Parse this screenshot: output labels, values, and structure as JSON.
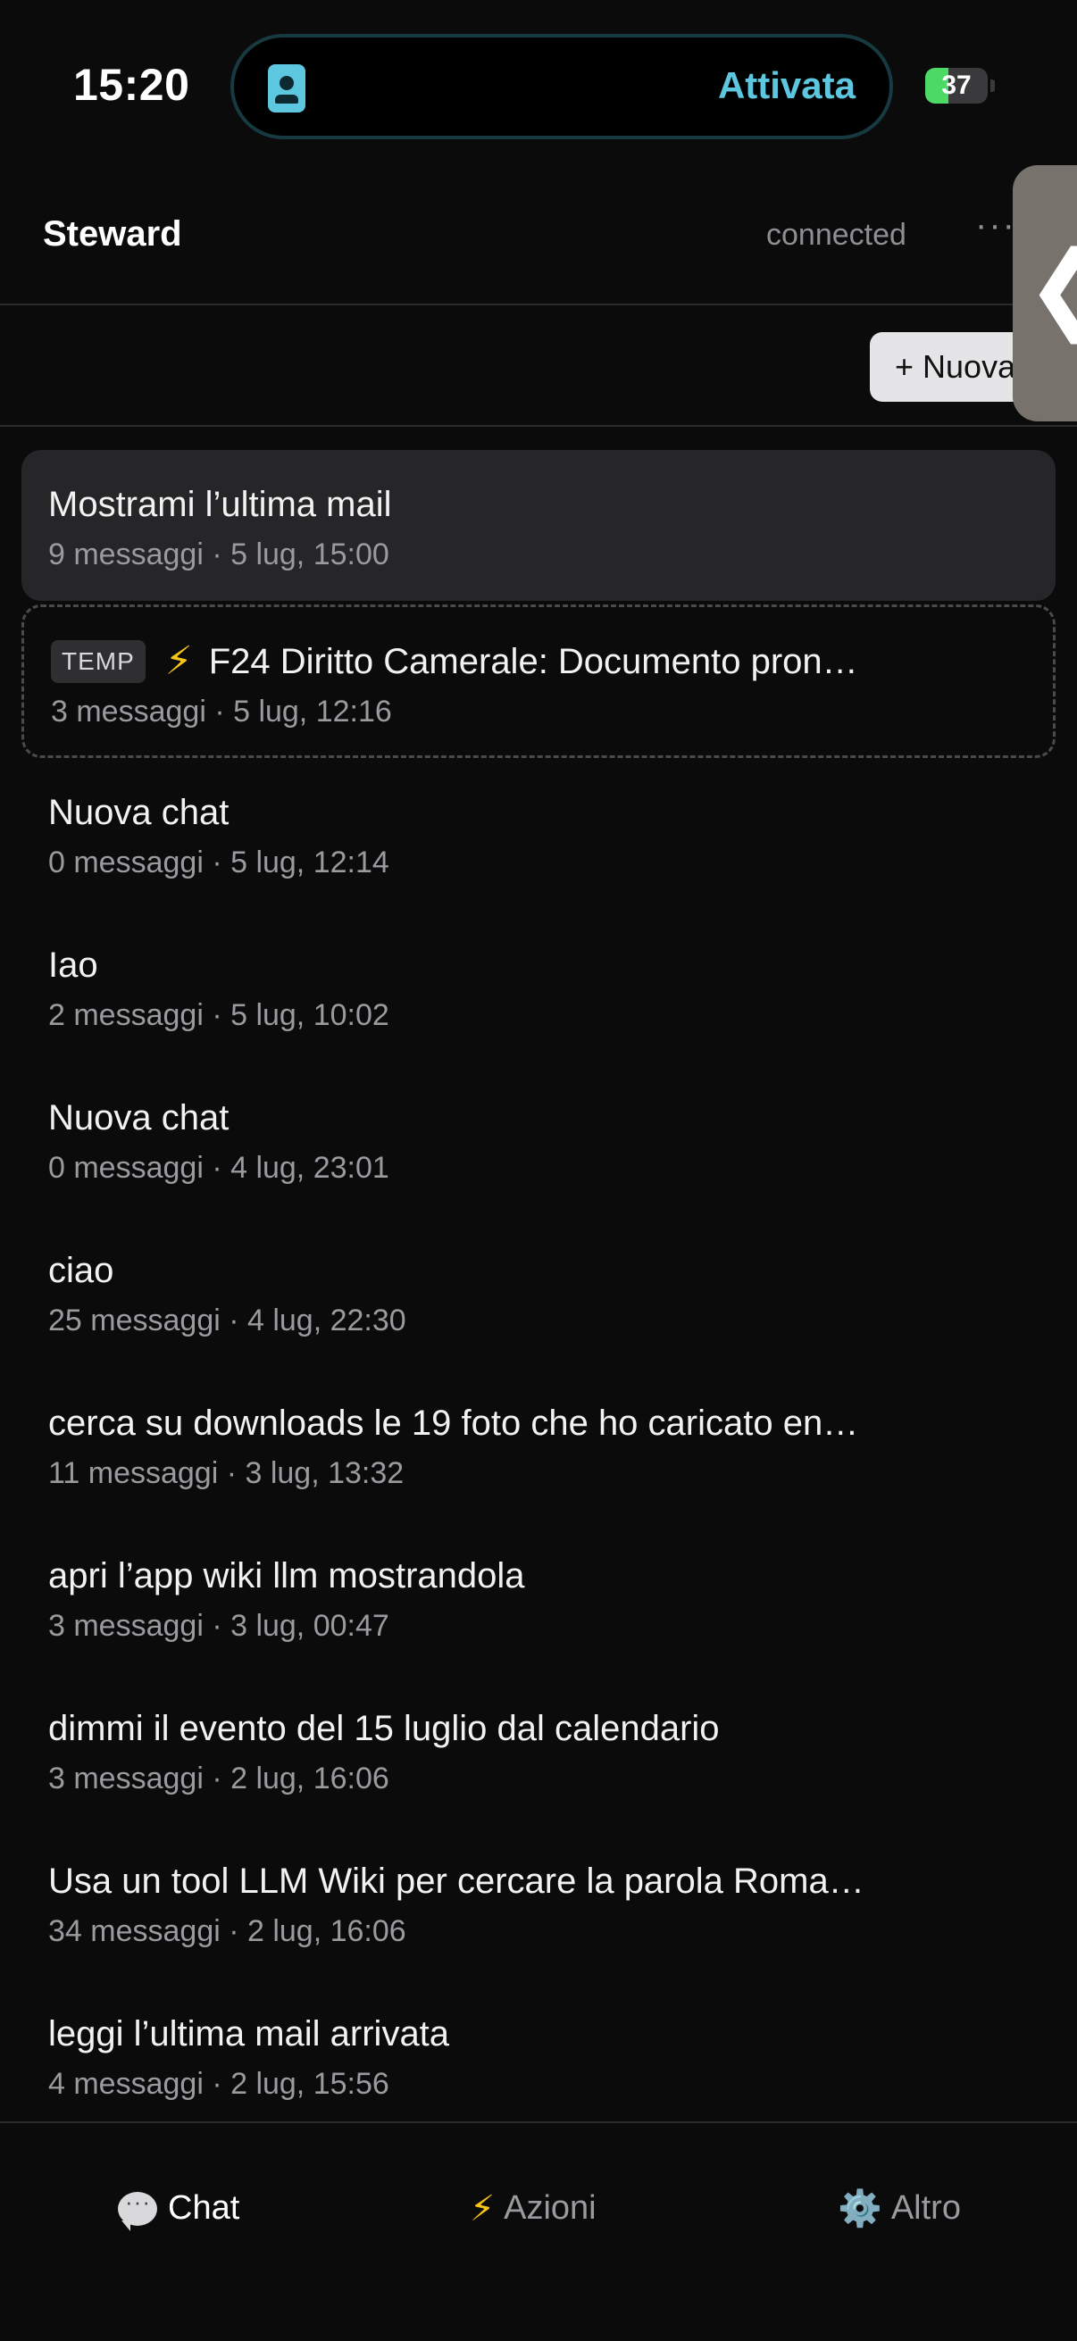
{
  "status_bar": {
    "time": "15:20",
    "activity_text": "Attivata",
    "activity_icon": "badge-icon",
    "battery_level": 37,
    "battery_text": "37",
    "accent_color": "#5cc7df"
  },
  "header": {
    "title": "Steward",
    "connection_status": "connected",
    "more_label": "···"
  },
  "side_handle": {
    "glyph": "❮"
  },
  "toolbar": {
    "new_label": "+ Nuova"
  },
  "chats": [
    {
      "title": "Mostrami l’ultima mail",
      "meta": "9 messaggi · 5 lug, 15:00",
      "active": true
    },
    {
      "badge": "TEMP",
      "title": "F24 Diritto Camerale: Documento pron…",
      "meta": "3 messaggi · 5 lug, 12:16",
      "temp": true
    },
    {
      "title": "Nuova chat",
      "meta": "0 messaggi · 5 lug, 12:14"
    },
    {
      "title": "Iao",
      "meta": "2 messaggi · 5 lug, 10:02"
    },
    {
      "title": "Nuova chat",
      "meta": "0 messaggi · 4 lug, 23:01"
    },
    {
      "title": "ciao",
      "meta": "25 messaggi · 4 lug, 22:30"
    },
    {
      "title": "cerca su downloads le 19 foto che ho caricato en…",
      "meta": "11 messaggi · 3 lug, 13:32"
    },
    {
      "title": "apri l’app wiki llm mostrandola",
      "meta": "3 messaggi · 3 lug, 00:47"
    },
    {
      "title": "dimmi il evento del 15 luglio dal calendario",
      "meta": "3 messaggi · 2 lug, 16:06"
    },
    {
      "title": "Usa un tool LLM Wiki per cercare la parola Roma…",
      "meta": "34 messaggi · 2 lug, 16:06"
    },
    {
      "title": "leggi l’ultima mail arrivata",
      "meta": "4 messaggi · 2 lug, 15:56"
    }
  ],
  "tabs": [
    {
      "label": "Chat",
      "icon": "speech-bubble-icon",
      "active": true
    },
    {
      "label": "Azioni",
      "icon": "lightning-icon",
      "glyph": "⚡"
    },
    {
      "label": "Altro",
      "icon": "gear-icon",
      "glyph": "⚙️"
    }
  ]
}
